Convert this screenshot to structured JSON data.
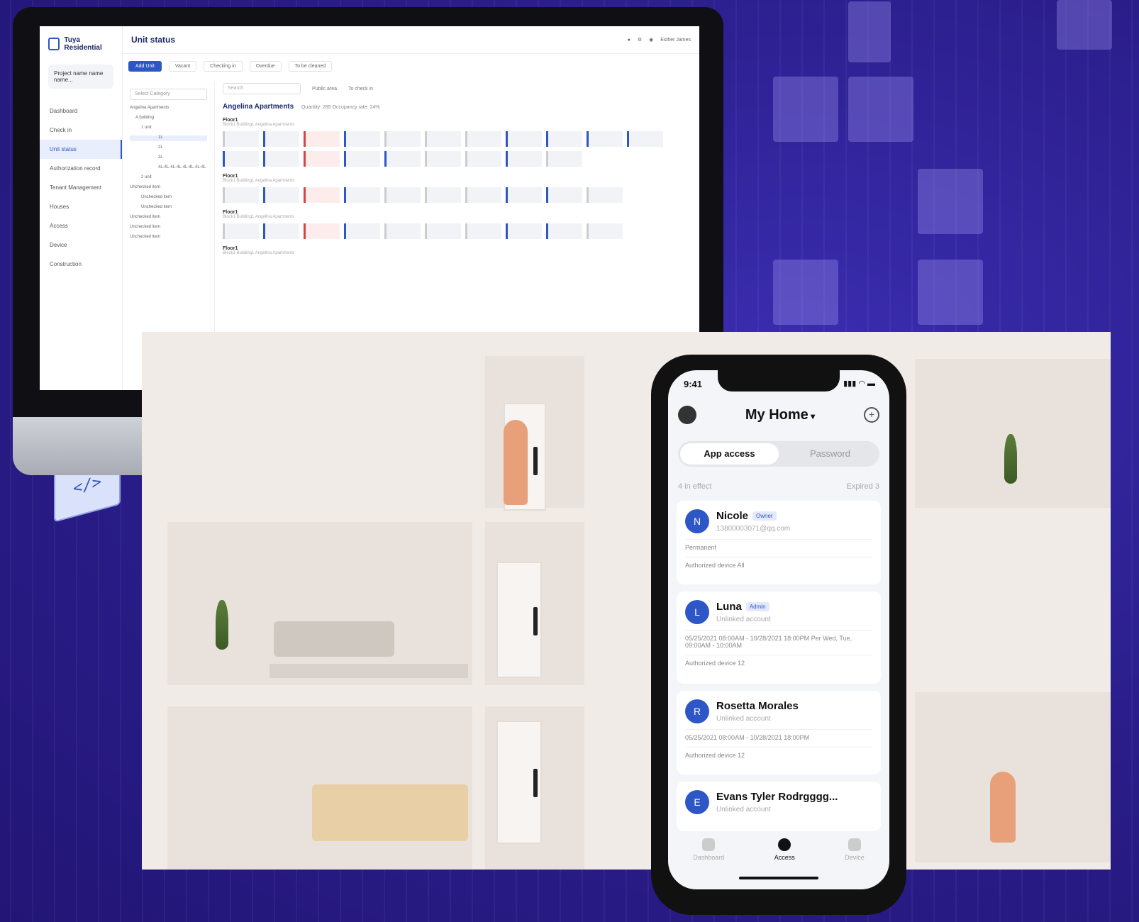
{
  "desktop": {
    "brand": "Tuya Residential",
    "page_title": "Unit status",
    "user_name": "Esther James",
    "project_selector": "Project name name name...",
    "nav": [
      {
        "label": "Dashboard"
      },
      {
        "label": "Check in"
      },
      {
        "label": "Unit status"
      },
      {
        "label": "Authorization record"
      },
      {
        "label": "Tenant Management"
      },
      {
        "label": "Houses"
      },
      {
        "label": "Access"
      },
      {
        "label": "Device"
      },
      {
        "label": "Construction"
      }
    ],
    "toolbar": {
      "primary_button": "Add Unit",
      "chips": [
        "Vacant",
        "Checking in",
        "Overdue",
        "To be cleaned"
      ]
    },
    "tree": {
      "select_placeholder": "Select Category",
      "items": [
        "Angelina Apartments",
        "A building",
        "1 unit",
        "1L",
        "2L",
        "3L",
        "4L-4L-4L-4L-4L-4L-4L-4L",
        "2 unit",
        "Unchecked item",
        "Unchecked item",
        "Unchecked item",
        "Unchecked item",
        "Unchecked item",
        "Unchecked item"
      ]
    },
    "search_placeholder": "Search",
    "filters": [
      "Public area",
      "To check in"
    ],
    "building": {
      "name": "Angelina Apartments",
      "meta": "Quantity: 285  Occupancy rate: 24%"
    },
    "floors": [
      {
        "title": "Floor1",
        "sub": "Block1 Building1 Angelina Apartments"
      },
      {
        "title": "Floor1",
        "sub": "Block1 Building1 Angelina Apartments"
      },
      {
        "title": "Floor1",
        "sub": "Block1 Building1 Angelina Apartments"
      },
      {
        "title": "Floor1",
        "sub": "Block1 Building1 Angelina Apartments"
      }
    ]
  },
  "phone": {
    "time": "9:41",
    "title": "My Home",
    "segments": {
      "active": "App access",
      "inactive": "Password"
    },
    "in_effect": "4 in effect",
    "expired": "Expired 3",
    "users": [
      {
        "initial": "N",
        "name": "Nicole",
        "role": "Owner",
        "sub": "13800003071@qq.com",
        "line1": "Permanent",
        "line2": "Authorized device  All"
      },
      {
        "initial": "L",
        "name": "Luna",
        "role": "Admin",
        "sub": "Unlinked account",
        "line1": "05/25/2021 08:00AM - 10/28/2021 18:00PM  Per Wed, Tue, 09:00AM - 10:00AM",
        "line2": "Authorized device  12"
      },
      {
        "initial": "R",
        "name": "Rosetta Morales",
        "role": "",
        "sub": "Unlinked account",
        "line1": "05/25/2021 08:00AM - 10/28/2021 18:00PM",
        "line2": "Authorized device  12"
      },
      {
        "initial": "E",
        "name": "Evans Tyler Rodrgggg...",
        "role": "",
        "sub": "Unlinked account",
        "line1": "",
        "line2": ""
      }
    ],
    "tabs": {
      "left": "Dashboard",
      "center": "Access",
      "right": "Device"
    }
  },
  "colors": {
    "accent": "#2d56c7",
    "background": "#2a1d8a"
  }
}
